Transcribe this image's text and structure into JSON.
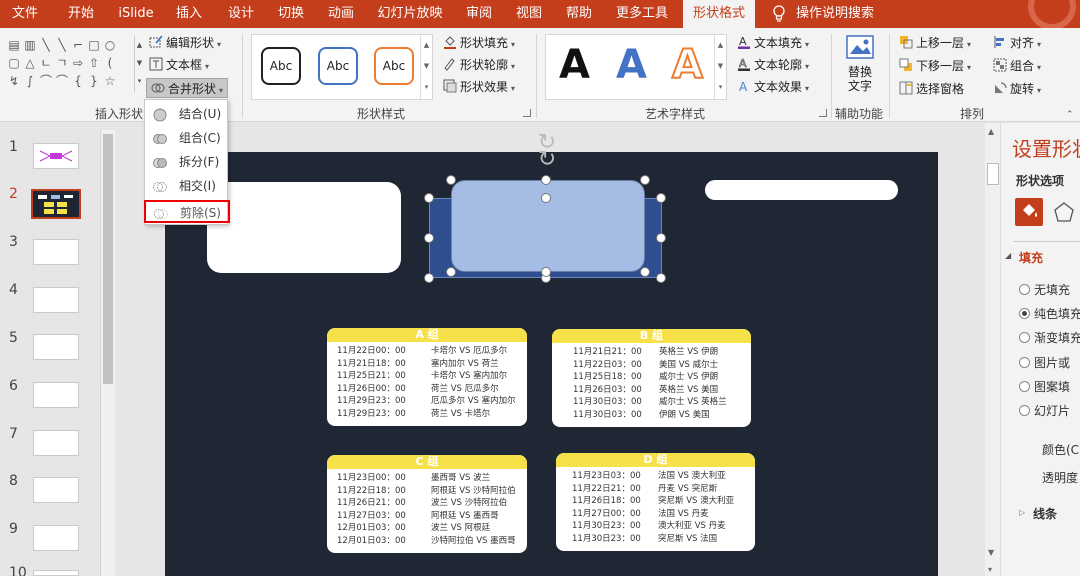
{
  "menu": {
    "tabs": [
      "文件",
      "开始",
      "iSlide",
      "插入",
      "设计",
      "切换",
      "动画",
      "幻灯片放映",
      "审阅",
      "视图",
      "帮助",
      "更多工具",
      "形状格式"
    ],
    "active_tab": "形状格式",
    "help_search": "操作说明搜索"
  },
  "colors": {
    "accent": "#c43e1c",
    "slide_bg": "#1f2634",
    "card_header": "#f7e14b",
    "selected_shape": "#a5bde4",
    "highlight_box": "#ee0000"
  },
  "ribbon": {
    "insert_shapes": {
      "label": "插入形状",
      "edit_shape": "编辑形状",
      "textbox": "文本框",
      "merge_shapes": "合并形状"
    },
    "shape_styles": {
      "label": "形状样式",
      "samples": [
        "Abc",
        "Abc",
        "Abc"
      ],
      "fill": "形状填充",
      "outline": "形状轮廓",
      "effects": "形状效果"
    },
    "wordart": {
      "label": "艺术字样式",
      "samples": [
        "A",
        "A",
        "A"
      ],
      "text_fill": "文本填充",
      "text_outline": "文本轮廓",
      "text_effects": "文本效果"
    },
    "accessibility": {
      "label": "辅助功能",
      "alt_text_line1": "替换",
      "alt_text_line2": "文字"
    },
    "arrange": {
      "label": "排列",
      "bring_forward": "上移一层",
      "send_backward": "下移一层",
      "selection_pane": "选择窗格",
      "align": "对齐",
      "group": "组合",
      "rotate": "旋转"
    }
  },
  "merge_menu": {
    "items": [
      "结合(U)",
      "组合(C)",
      "拆分(F)",
      "相交(I)",
      "剪除(S)"
    ],
    "highlighted": "剪除(S)"
  },
  "thumbnails": {
    "numbers": [
      "1",
      "2",
      "3",
      "4",
      "5",
      "6",
      "7",
      "8",
      "9",
      "10"
    ],
    "selected": "2"
  },
  "slide": {
    "groups": [
      {
        "title": "A 组",
        "rows": [
          {
            "time": "11月22日00：00",
            "match": "卡塔尔 VS 厄瓜多尔"
          },
          {
            "time": "11月21日18：00",
            "match": "塞内加尔 VS 荷兰"
          },
          {
            "time": "11月25日21：00",
            "match": "卡塔尔 VS 塞内加尔"
          },
          {
            "time": "11月26日00：00",
            "match": "荷兰 VS 厄瓜多尔"
          },
          {
            "time": "11月29日23：00",
            "match": "厄瓜多尔 VS 塞内加尔"
          },
          {
            "time": "11月29日23：00",
            "match": "荷兰 VS 卡塔尔"
          }
        ]
      },
      {
        "title": "B 组",
        "rows": [
          {
            "time": "11月21日21：00",
            "match": "英格兰 VS 伊朗"
          },
          {
            "time": "11月22日03：00",
            "match": "美国 VS 威尔士"
          },
          {
            "time": "11月25日18：00",
            "match": "威尔士 VS 伊朗"
          },
          {
            "time": "11月26日03：00",
            "match": "英格兰 VS 美国"
          },
          {
            "time": "11月30日03：00",
            "match": "威尔士 VS 英格兰"
          },
          {
            "time": "11月30日03：00",
            "match": "伊朗 VS 美国"
          }
        ]
      },
      {
        "title": "C 组",
        "rows": [
          {
            "time": "11月23日00：00",
            "match": "墨西哥 VS 波兰"
          },
          {
            "time": "11月22日18：00",
            "match": "阿根廷 VS 沙特阿拉伯"
          },
          {
            "time": "11月26日21：00",
            "match": "波兰 VS 沙特阿拉伯"
          },
          {
            "time": "11月27日03：00",
            "match": "阿根廷 VS 墨西哥"
          },
          {
            "time": "12月01日03：00",
            "match": "波兰 VS 阿根廷"
          },
          {
            "time": "12月01日03：00",
            "match": "沙特阿拉伯 VS 墨西哥"
          }
        ]
      },
      {
        "title": "D 组",
        "rows": [
          {
            "time": "11月23日03：00",
            "match": "法国 VS 澳大利亚"
          },
          {
            "time": "11月22日21：00",
            "match": "丹麦 VS 突尼斯"
          },
          {
            "time": "11月26日18：00",
            "match": "突尼斯 VS 澳大利亚"
          },
          {
            "time": "11月27日00：00",
            "match": "法国 VS 丹麦"
          },
          {
            "time": "11月30日23：00",
            "match": "澳大利亚 VS 丹麦"
          },
          {
            "time": "11月30日23：00",
            "match": "突尼斯 VS 法国"
          }
        ]
      }
    ]
  },
  "format_pane": {
    "title": "设置形状",
    "subtitle": "形状选项",
    "fill_section": "填充",
    "fill_options": [
      "无填充",
      "纯色填充",
      "渐变填充",
      "图片或",
      "图案填",
      "幻灯片"
    ],
    "selected_fill": "纯色填充",
    "color_label": "颜色(C",
    "transparency_label": "透明度",
    "line_section": "线条"
  }
}
